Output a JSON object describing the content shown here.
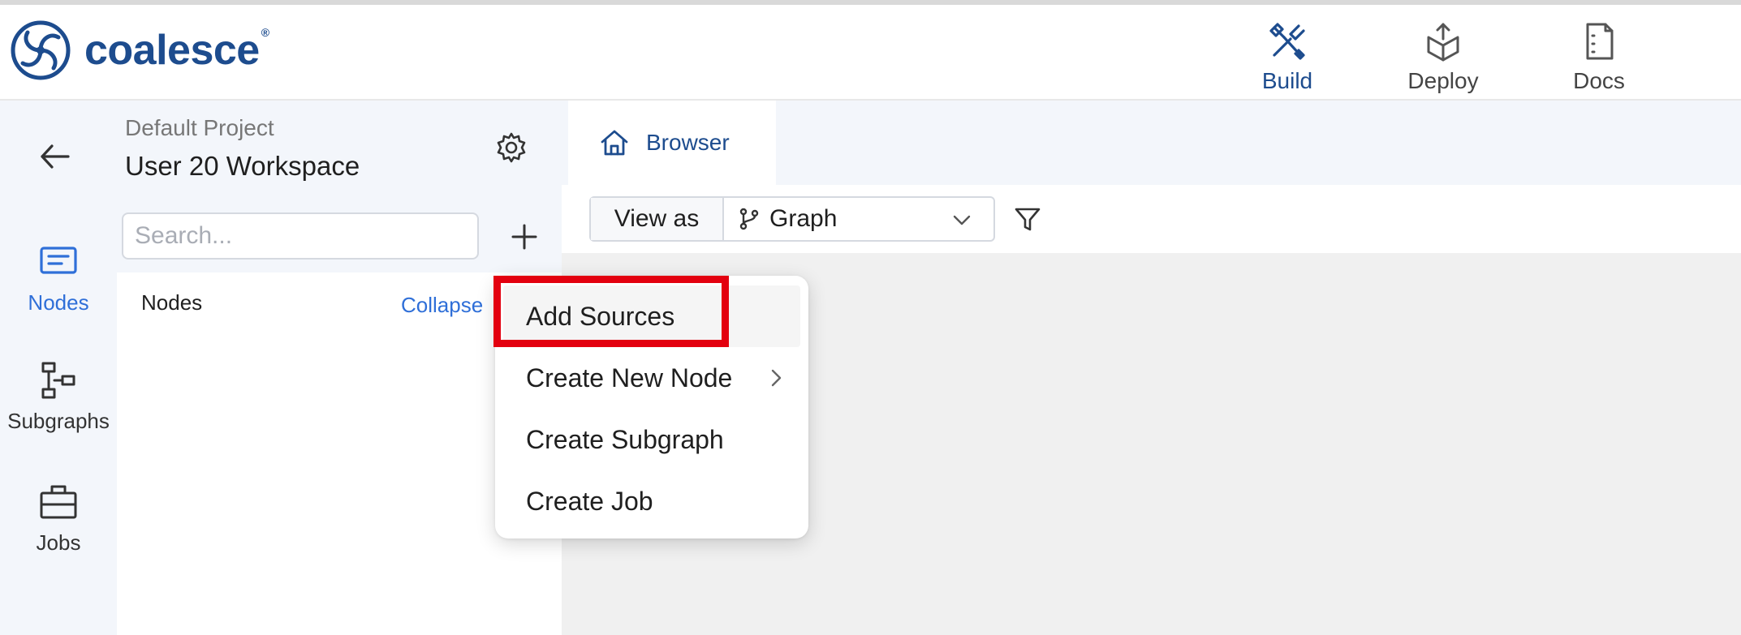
{
  "brand": {
    "name": "coalesce",
    "reg": "®"
  },
  "topnav": [
    {
      "label": "Build",
      "icon": "hammer-wrench-icon",
      "active": true
    },
    {
      "label": "Deploy",
      "icon": "box-upload-icon",
      "active": false
    },
    {
      "label": "Docs",
      "icon": "document-icon",
      "active": false
    }
  ],
  "rail": [
    {
      "label": "Nodes",
      "icon": "nodes-icon",
      "active": true
    },
    {
      "label": "Subgraphs",
      "icon": "subgraph-icon",
      "active": false
    },
    {
      "label": "Jobs",
      "icon": "briefcase-icon",
      "active": false
    }
  ],
  "panel": {
    "project": "Default Project",
    "workspace": "User 20 Workspace",
    "search_placeholder": "Search...",
    "nodes_title": "Nodes",
    "collapse_label": "Collapse"
  },
  "main": {
    "tab_label": "Browser",
    "view_as_label": "View as",
    "view_value": "Graph"
  },
  "menu": {
    "items": [
      {
        "label": "Add Sources",
        "has_submenu": false
      },
      {
        "label": "Create New Node",
        "has_submenu": true
      },
      {
        "label": "Create Subgraph",
        "has_submenu": false
      },
      {
        "label": "Create Job",
        "has_submenu": false
      }
    ]
  },
  "colors": {
    "brand": "#1d4c8e",
    "accent": "#2f6fd8",
    "highlight": "#e3000f"
  }
}
